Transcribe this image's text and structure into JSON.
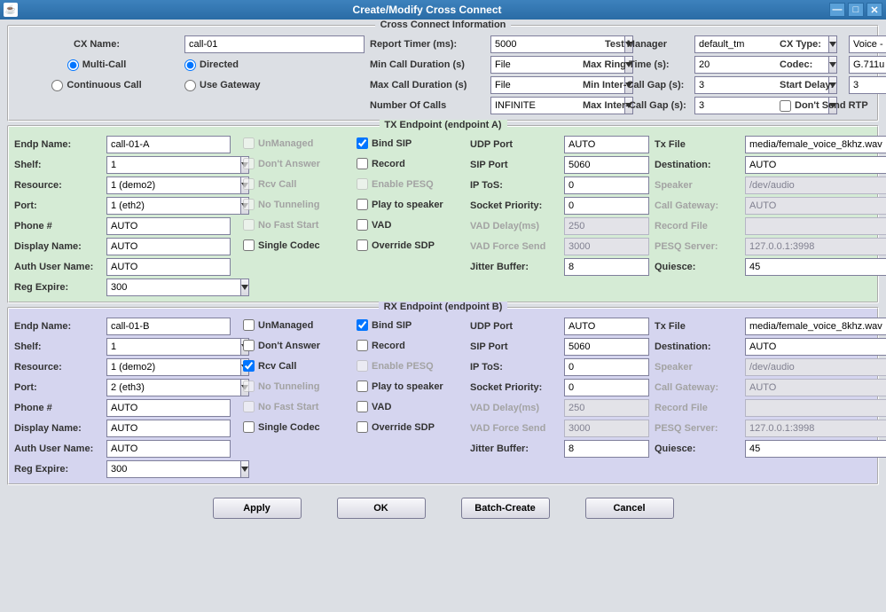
{
  "window": {
    "title": "Create/Modify Cross Connect"
  },
  "top": {
    "section_title": "Cross Connect Information",
    "cx_name_lbl": "CX Name:",
    "cx_name": "call-01",
    "report_timer_lbl": "Report Timer (ms):",
    "report_timer": "5000",
    "test_mgr_lbl": "Test Manager",
    "test_mgr": "default_tm",
    "cx_type_lbl": "CX Type:",
    "cx_type": "Voice - SIP",
    "multi_call": "Multi-Call",
    "directed": "Directed",
    "continuous": "Continuous Call",
    "use_gateway": "Use Gateway",
    "min_dur_lbl": "Min Call Duration (s)",
    "min_dur": "File",
    "max_dur_lbl": "Max Call Duration (s)",
    "max_dur": "File",
    "num_calls_lbl": "Number Of Calls",
    "num_calls": "INFINITE",
    "max_ring_lbl": "Max Ring Time (s):",
    "max_ring": "20",
    "min_gap_lbl": "Min Inter-Call Gap (s):",
    "min_gap": "3",
    "max_gap_lbl": "Max Inter-Call Gap (s):",
    "max_gap": "3",
    "codec_lbl": "Codec:",
    "codec": "G.711u",
    "start_delay_lbl": "Start Delay:",
    "start_delay": "3",
    "dont_send_rtp": "Don't Send RTP"
  },
  "tx": {
    "section_title": "TX Endpoint (endpoint A)",
    "endp_name_lbl": "Endp Name:",
    "endp_name": "call-01-A",
    "shelf_lbl": "Shelf:",
    "shelf": "1",
    "resource_lbl": "Resource:",
    "resource": "1 (demo2)",
    "port_lbl": "Port:",
    "port": "1 (eth2)",
    "phone_lbl": "Phone #",
    "phone": "AUTO",
    "display_name_lbl": "Display Name:",
    "display_name": "AUTO",
    "auth_user_lbl": "Auth User Name:",
    "auth_user": "AUTO",
    "reg_expire_lbl": "Reg Expire:",
    "reg_expire": "300",
    "unmanaged": "UnManaged",
    "dont_answer": "Don't Answer",
    "rcv_call": "Rcv Call",
    "no_tunneling": "No Tunneling",
    "no_fast_start": "No Fast Start",
    "single_codec": "Single Codec",
    "bind_sip": "Bind SIP",
    "record": "Record",
    "enable_pesq": "Enable PESQ",
    "play_speaker": "Play to speaker",
    "vad": "VAD",
    "override_sdp": "Override SDP",
    "udp_port_lbl": "UDP Port",
    "udp_port": "AUTO",
    "sip_port_lbl": "SIP Port",
    "sip_port": "5060",
    "ip_tos_lbl": "IP ToS:",
    "ip_tos": "0",
    "sock_prio_lbl": "Socket Priority:",
    "sock_prio": "0",
    "vad_delay_lbl": "VAD Delay(ms)",
    "vad_delay": "250",
    "vad_force_lbl": "VAD Force Send",
    "vad_force": "3000",
    "jitter_lbl": "Jitter Buffer:",
    "jitter": "8",
    "tx_file_lbl": "Tx File",
    "tx_file": "media/female_voice_8khz.wav",
    "dest_lbl": "Destination:",
    "dest": "AUTO",
    "speaker_lbl": "Speaker",
    "speaker": "/dev/audio",
    "call_gw_lbl": "Call Gateway:",
    "call_gw": "AUTO",
    "rec_file_lbl": "Record File",
    "rec_file": "",
    "pesq_srv_lbl": "PESQ Server:",
    "pesq_srv": "127.0.0.1:3998",
    "quiesce_lbl": "Quiesce:",
    "quiesce": "45"
  },
  "rx": {
    "section_title": "RX Endpoint (endpoint B)",
    "endp_name_lbl": "Endp Name:",
    "endp_name": "call-01-B",
    "shelf_lbl": "Shelf:",
    "shelf": "1",
    "resource_lbl": "Resource:",
    "resource": "1 (demo2)",
    "port_lbl": "Port:",
    "port": "2 (eth3)",
    "phone_lbl": "Phone #",
    "phone": "AUTO",
    "display_name_lbl": "Display Name:",
    "display_name": "AUTO",
    "auth_user_lbl": "Auth User Name:",
    "auth_user": "AUTO",
    "reg_expire_lbl": "Reg Expire:",
    "reg_expire": "300",
    "unmanaged": "UnManaged",
    "dont_answer": "Don't Answer",
    "rcv_call": "Rcv Call",
    "no_tunneling": "No Tunneling",
    "no_fast_start": "No Fast Start",
    "single_codec": "Single Codec",
    "bind_sip": "Bind SIP",
    "record": "Record",
    "enable_pesq": "Enable PESQ",
    "play_speaker": "Play to speaker",
    "vad": "VAD",
    "override_sdp": "Override SDP",
    "udp_port_lbl": "UDP Port",
    "udp_port": "AUTO",
    "sip_port_lbl": "SIP Port",
    "sip_port": "5060",
    "ip_tos_lbl": "IP ToS:",
    "ip_tos": "0",
    "sock_prio_lbl": "Socket Priority:",
    "sock_prio": "0",
    "vad_delay_lbl": "VAD Delay(ms)",
    "vad_delay": "250",
    "vad_force_lbl": "VAD Force Send",
    "vad_force": "3000",
    "jitter_lbl": "Jitter Buffer:",
    "jitter": "8",
    "tx_file_lbl": "Tx File",
    "tx_file": "media/female_voice_8khz.wav",
    "dest_lbl": "Destination:",
    "dest": "AUTO",
    "speaker_lbl": "Speaker",
    "speaker": "/dev/audio",
    "call_gw_lbl": "Call Gateway:",
    "call_gw": "AUTO",
    "rec_file_lbl": "Record File",
    "rec_file": "",
    "pesq_srv_lbl": "PESQ Server:",
    "pesq_srv": "127.0.0.1:3998",
    "quiesce_lbl": "Quiesce:",
    "quiesce": "45"
  },
  "buttons": {
    "apply": "Apply",
    "ok": "OK",
    "batch": "Batch-Create",
    "cancel": "Cancel"
  }
}
